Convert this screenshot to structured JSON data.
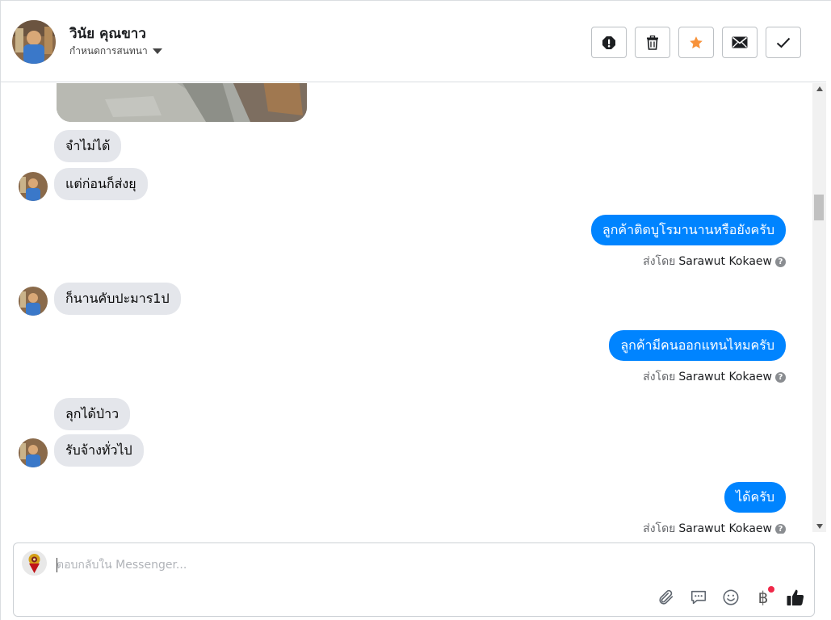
{
  "header": {
    "contact_name": "วินัย คุณขาว",
    "conversation_settings": "กำหนดการสนทนา"
  },
  "messages": [
    {
      "id": "m1",
      "direction": "in",
      "text": "จำไม่ได้"
    },
    {
      "id": "m2",
      "direction": "in",
      "text": "แต่ก่อนก็ส่งยุ"
    },
    {
      "id": "m3",
      "direction": "out",
      "text": "ลูกค้าติดบูโรมานานหรือยังครับ"
    },
    {
      "id": "m4",
      "direction": "in",
      "text": "ก็นานคับปะมาร1ป"
    },
    {
      "id": "m5",
      "direction": "out",
      "text": "ลูกค้ามีคนออกแทนไหมครับ"
    },
    {
      "id": "m6",
      "direction": "in",
      "text": "ลุกได้ป่าว"
    },
    {
      "id": "m7",
      "direction": "in",
      "text": "รับจ้างทั่วไป"
    },
    {
      "id": "m8",
      "direction": "out",
      "text": "ได้ครับ"
    }
  ],
  "sent_by": {
    "prefix": "ส่งโดย",
    "name": "Sarawut Kokaew",
    "help": "?"
  },
  "composer": {
    "placeholder": "ตอบกลับใน Messenger..."
  },
  "tools": {
    "currency": "฿"
  },
  "colors": {
    "accent": "#0084ff",
    "incoming_bubble": "#e4e6eb",
    "star": "#f7923a"
  },
  "icons": [
    "alert-icon",
    "trash-icon",
    "star-icon",
    "envelope-icon",
    "check-icon",
    "paperclip-icon",
    "saved-reply-icon",
    "emoji-icon",
    "baht-icon",
    "thumbs-up-icon"
  ]
}
